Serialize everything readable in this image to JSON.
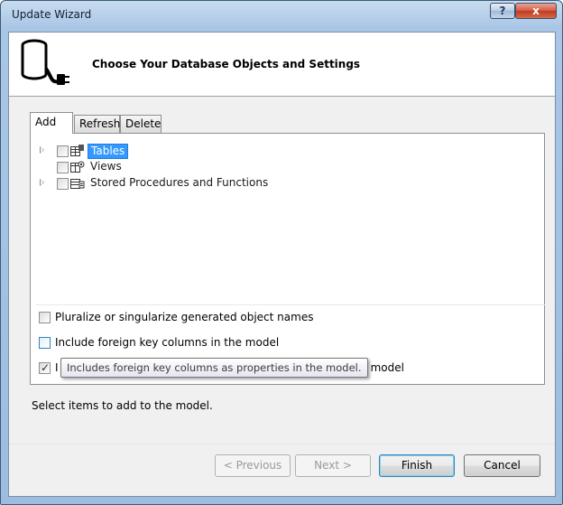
{
  "window": {
    "title": "Update Wizard",
    "help_glyph": "?",
    "close_glyph": "x"
  },
  "header": {
    "title": "Choose Your Database Objects and Settings",
    "icon": "database-plug-icon"
  },
  "tabs": [
    {
      "label": "Add",
      "active": true
    },
    {
      "label": "Refresh",
      "active": false
    },
    {
      "label": "Delete",
      "active": false
    }
  ],
  "tree": [
    {
      "label": "Tables",
      "expandable": true,
      "checked": false,
      "selected": true,
      "icon": "table-icon"
    },
    {
      "label": "Views",
      "expandable": false,
      "checked": false,
      "selected": false,
      "icon": "view-icon"
    },
    {
      "label": "Stored Procedures and Functions",
      "expandable": true,
      "checked": false,
      "selected": false,
      "icon": "stored-procedure-icon"
    }
  ],
  "options": [
    {
      "label": "Pluralize or singularize generated object names",
      "checked": false
    },
    {
      "label": "Include foreign key columns in the model",
      "checked": false
    },
    {
      "label_start": "I",
      "label_end": "ty model",
      "checked": true
    }
  ],
  "tooltip": "Includes foreign key columns as properties in the model.",
  "status": "Select items to add to the model.",
  "buttons": {
    "previous": "< Previous",
    "next": "Next >",
    "finish": "Finish",
    "cancel": "Cancel"
  },
  "colors": {
    "selection": "#3399ff",
    "titlebar": "#a9c6e6",
    "close_button": "#c03a1c"
  }
}
